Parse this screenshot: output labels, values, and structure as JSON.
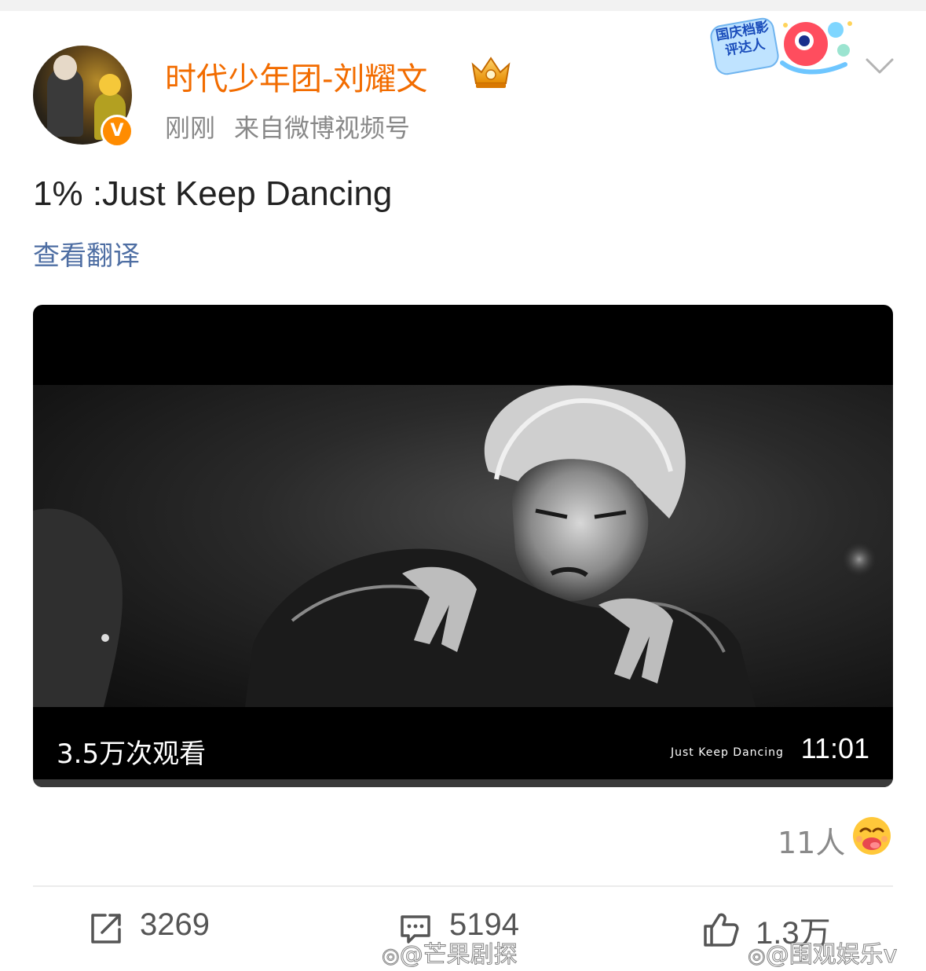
{
  "post": {
    "username": "时代少年团-刘耀文",
    "time": "刚刚",
    "source": "来自微博视频号",
    "text": "1% :Just Keep Dancing",
    "translate": "查看翻译",
    "event_badge": "国庆档影评达人",
    "verified_badge": "V"
  },
  "video": {
    "views": "3.5万次观看",
    "overlay_title": "Just Keep Dancing",
    "duration": "11:01"
  },
  "reactions": {
    "count": "11人"
  },
  "actions": {
    "repost": "3269",
    "comment": "5194",
    "like": "1.3万"
  },
  "watermarks": {
    "left": "@芒果剧探",
    "right": "@围观娱乐v"
  },
  "colors": {
    "username": "#f26c00",
    "link": "#4e6ea3",
    "meta": "#888888"
  }
}
